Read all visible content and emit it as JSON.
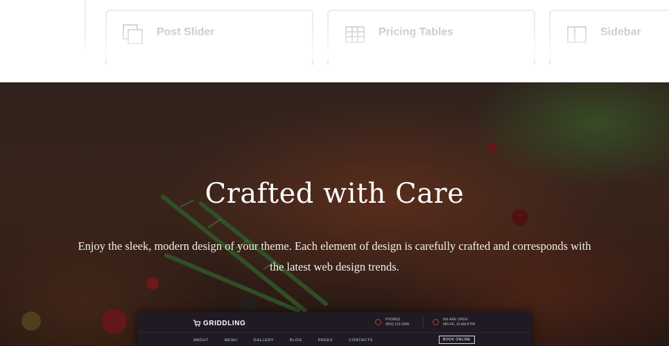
{
  "features": {
    "cards": [
      {
        "label": "Post Slider",
        "icon": "post-slider-icon"
      },
      {
        "label": "Pricing Tables",
        "icon": "pricing-tables-icon"
      },
      {
        "label": "Sidebar",
        "icon": "sidebar-icon"
      }
    ]
  },
  "hero": {
    "title": "Crafted with Care",
    "text": "Enjoy the sleek, modern design of your theme. Each element of design is carefully crafted and corresponds with the latest web design trends."
  },
  "preview": {
    "logo": "GRIDDLING",
    "phone_label": "PHONES",
    "phone_value": "(800) 123-0045",
    "hours_label": "WE ARE OPEN:",
    "hours_value": "MN-FR, 10 AM-8 PM",
    "nav": [
      "ABOUT",
      "MENU",
      "GALLERY",
      "BLOG",
      "PAGES",
      "CONTACTS"
    ],
    "book_button": "BOOK ONLINE"
  },
  "colors": {
    "card_border": "#ececec",
    "card_text": "#c7c7c7",
    "accent_red": "#c43c3c",
    "mock_bg": "#1f1a24"
  }
}
